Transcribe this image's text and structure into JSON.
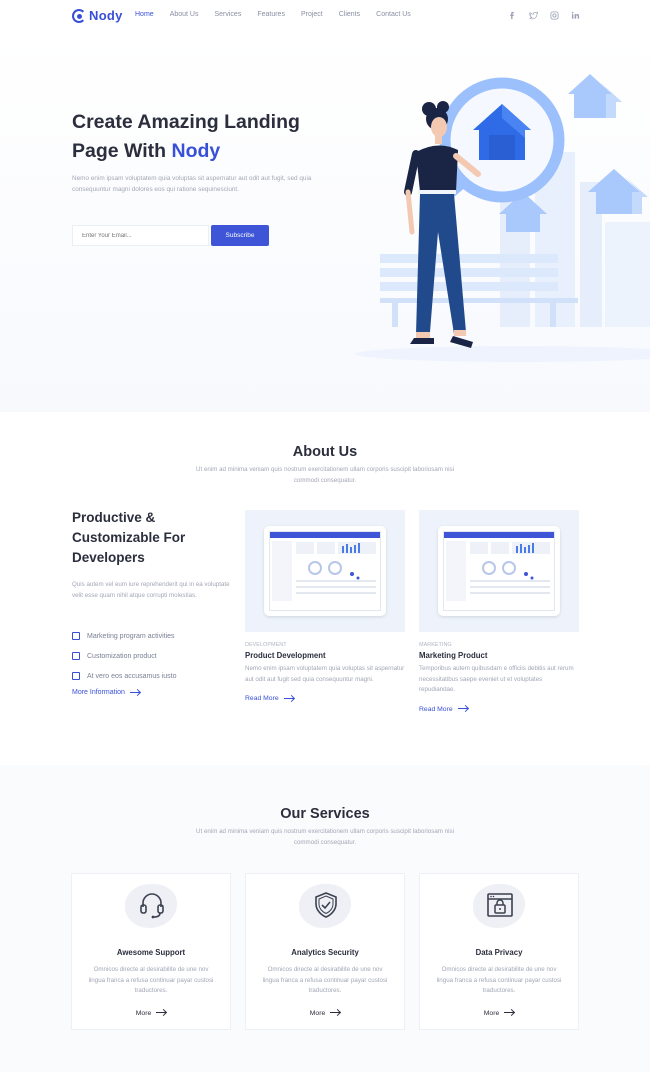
{
  "nav": {
    "logo": "Nody",
    "items": [
      "Home",
      "About Us",
      "Services",
      "Features",
      "Project",
      "Clients",
      "Contact Us"
    ],
    "social": [
      "facebook-icon",
      "twitter-icon",
      "instagram-icon",
      "linkedin-icon"
    ]
  },
  "hero": {
    "title_line1": "Create Amazing Landing",
    "title_line2_prefix": "Page With ",
    "title_accent": "Nody",
    "description": "Nemo enim ipsam voluptatem quia voluptas sit aspernatur aut odit aut fugit, sed quia consequuntur magni dolores eos qui ratione sequinesciunt.",
    "email_placeholder": "Enter Your Email...",
    "subscribe_label": "Subscribe"
  },
  "about": {
    "title": "About Us",
    "subtitle": "Ut enim ad minima veniam quis nostrum exercitationem ullam corporis suscipit laboriosam nisi commodi consequatur.",
    "heading_line1": "Productive &",
    "heading_line2": "Customizable For",
    "heading_line3": "Developers",
    "text": "Quis autem vel eum iure reprehenderit qui in ea voluptate velit esse quam nihil atque corrupti molestias.",
    "features": [
      "Marketing program activities",
      "Customization product",
      "At vero eos accusamus iusto"
    ],
    "more_link": "More Information",
    "cards": [
      {
        "tag": "DEVELOPMENT",
        "title": "Product Development",
        "text": "Nemo enim ipsam voluptatem quia voluptas sit aspernatur aut odit aut fugit sed quia consequuntur magni.",
        "link": "Read More"
      },
      {
        "tag": "MARKETING",
        "title": "Marketing Product",
        "text": "Temporibus autem quibusdam e officiis debitis aut rerum necessitatibus saepe eveniet ut et voluptates repudiandae.",
        "link": "Read More"
      }
    ]
  },
  "services": {
    "title": "Our Services",
    "subtitle": "Ut enim ad minima veniam quis nostrum exercitationem ullam corporis suscipit laboriosam nisi commodi consequatur.",
    "items": [
      {
        "icon": "headset-icon",
        "title": "Awesome Support",
        "text": "Omnicos directe al desirabilite de une nov lingua franca a refusa continuar payar custosi traductores.",
        "more": "More"
      },
      {
        "icon": "shield-check-icon",
        "title": "Analytics Security",
        "text": "Omnicos directe al desirabilite de une nov lingua franca a refusa continuar payar custosi traductores.",
        "more": "More"
      },
      {
        "icon": "lock-browser-icon",
        "title": "Data Privacy",
        "text": "Omnicos directe al desirabilite de une nov lingua franca a refusa continuar payar custosi traductores.",
        "more": "More"
      }
    ]
  },
  "colors": {
    "accent": "#3850d8",
    "text_dark": "#2b2e3c",
    "text_muted": "#a3a7b7",
    "illustration_light": "#a9c8fb"
  }
}
